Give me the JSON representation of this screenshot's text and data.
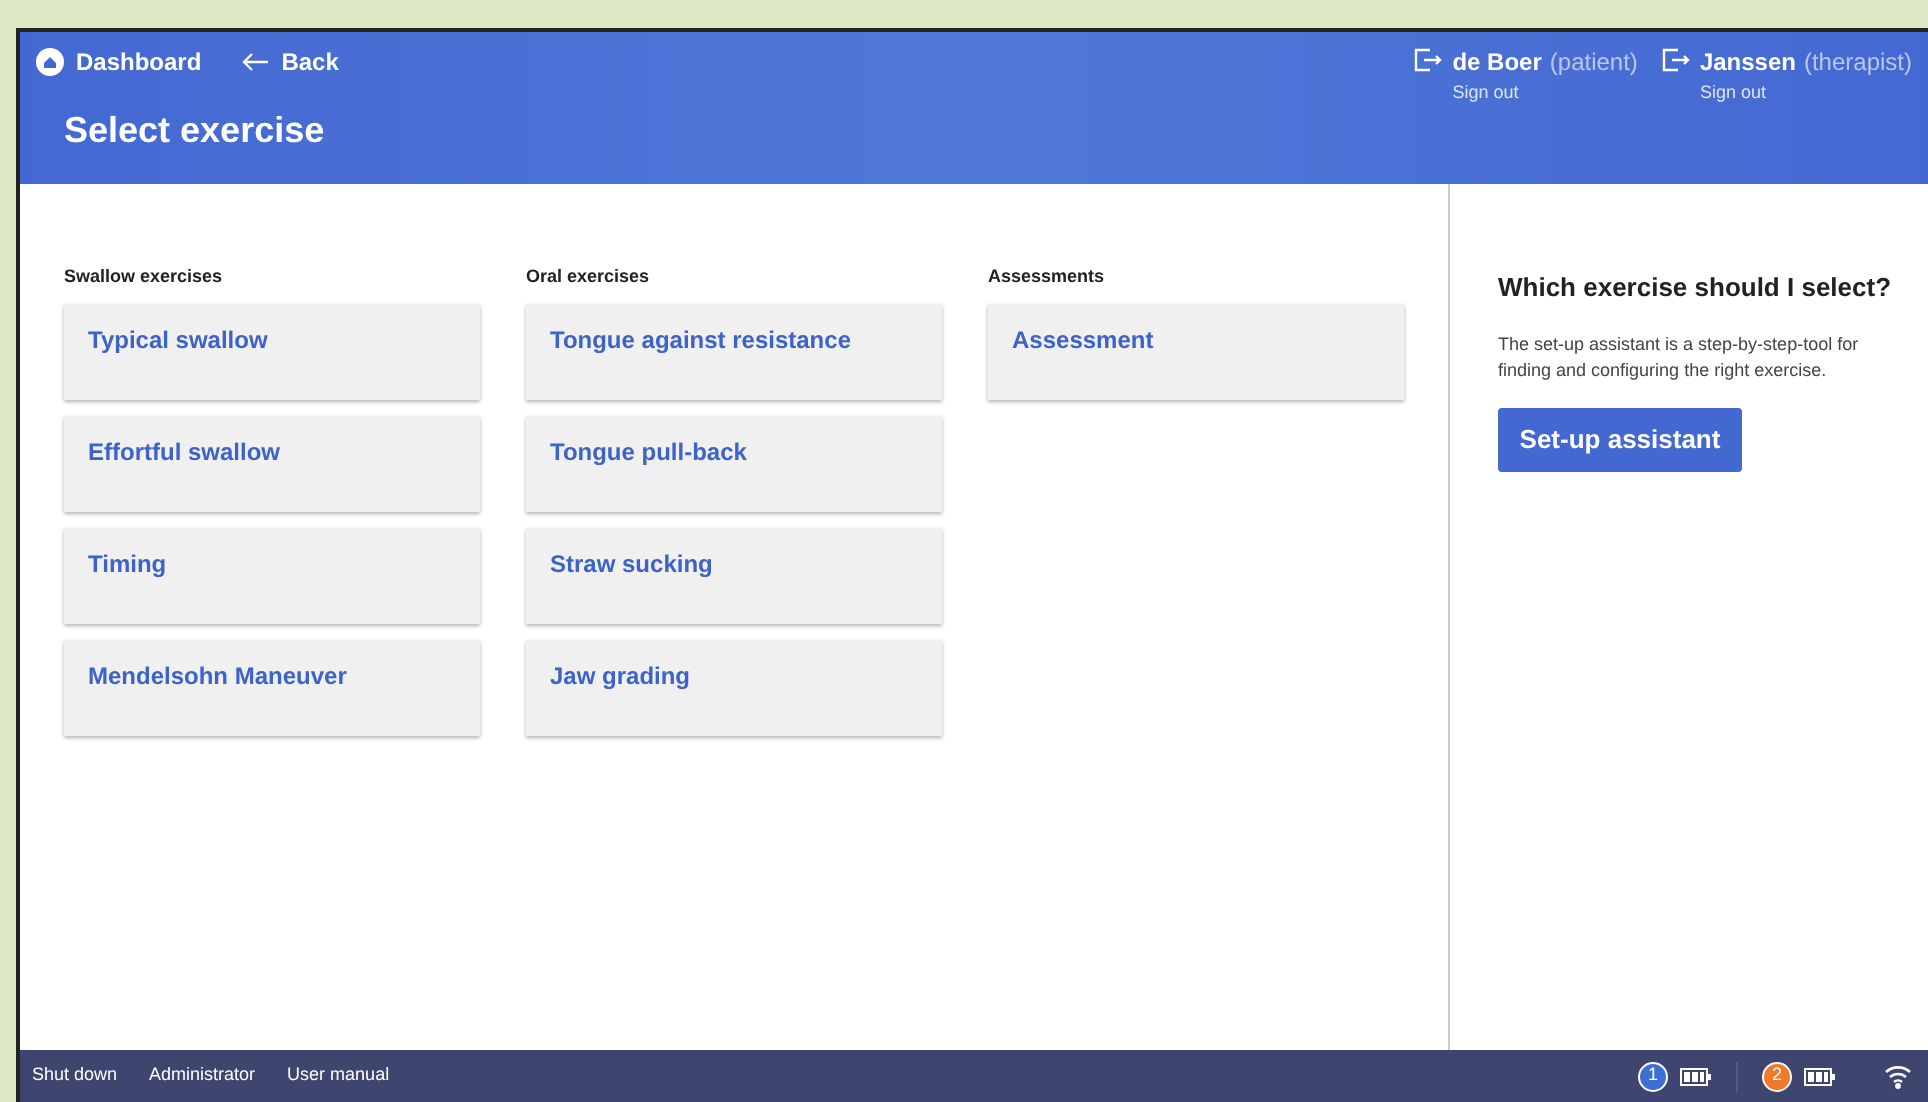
{
  "header": {
    "nav": [
      {
        "kind": "home",
        "label": "Dashboard"
      },
      {
        "kind": "back",
        "label": "Back"
      }
    ],
    "title": "Select exercise",
    "users": [
      {
        "name": "de Boer",
        "role": "(patient)",
        "action": "Sign out"
      },
      {
        "name": "Janssen",
        "role": "(therapist)",
        "action": "Sign out"
      }
    ]
  },
  "columns": [
    {
      "heading": "Swallow exercises",
      "items": [
        "Typical swallow",
        "Effortful swallow",
        "Timing",
        "Mendelsohn Maneuver"
      ]
    },
    {
      "heading": "Oral exercises",
      "items": [
        "Tongue against resistance",
        "Tongue pull-back",
        "Straw sucking",
        "Jaw grading"
      ]
    },
    {
      "heading": "Assessments",
      "items": [
        "Assessment"
      ]
    }
  ],
  "help": {
    "title": "Which exercise should I select?",
    "text": "The set-up assistant is a step-by-step-tool for finding and configuring the right exercise.",
    "button": "Set-up assistant"
  },
  "status_bar": {
    "links": [
      "Shut down",
      "Administrator",
      "User manual"
    ],
    "devices": [
      {
        "label": "1",
        "color": "#3b6fd6"
      },
      {
        "label": "2",
        "color": "#f07a2a"
      }
    ]
  }
}
